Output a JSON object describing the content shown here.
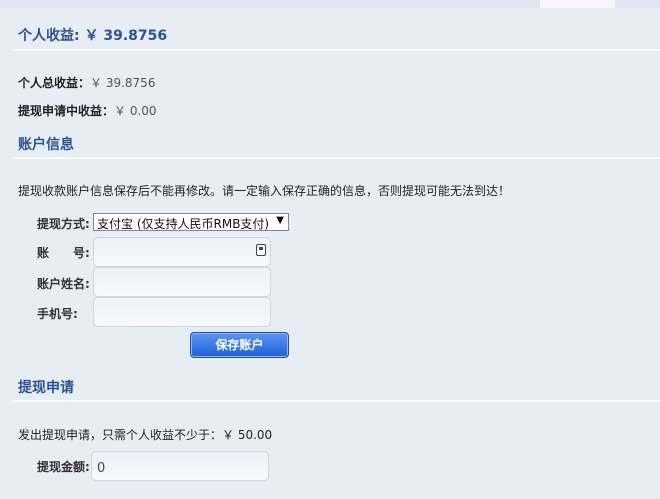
{
  "header": {
    "title": "个人收益: ￥ 39.8756"
  },
  "earnings": {
    "total_label": "个人总收益：",
    "total_value": "￥ 39.8756",
    "pending_label": "提现申请中收益：",
    "pending_value": "￥ 0.00"
  },
  "account": {
    "section_title": "账户信息",
    "notice": "提现收款账户信息保存后不能再修改。请一定输入保存正确的信息，否则提现可能无法到达！",
    "method_label": "提现方式:",
    "method_value": "支付宝 (仅支持人民币RMB支付)",
    "account_label": "账　　号: *",
    "account_value": "",
    "name_label": "账户姓名:",
    "name_value": "",
    "phone_label": "手机号:",
    "phone_value": "",
    "save_button": "保存账户"
  },
  "withdraw": {
    "section_title": "提现申请",
    "notice": "发出提现申请，只需个人收益不少于：￥ 50.00",
    "amount_label": "提现金额:",
    "amount_value": "0"
  }
}
